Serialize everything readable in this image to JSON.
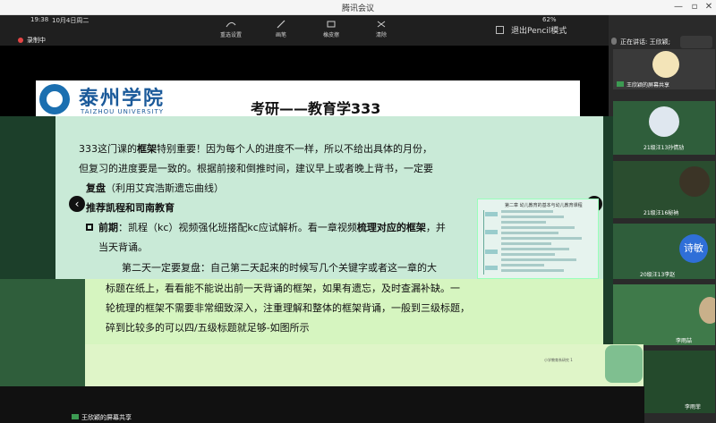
{
  "window": {
    "title": "腾讯会议"
  },
  "status": {
    "time": "19:38",
    "date": "10月4日周二",
    "battery": "62%"
  },
  "recording": {
    "label": "录制中"
  },
  "toolbar": {
    "items": [
      {
        "label": "重选设置",
        "icon": "pen-settings-icon"
      },
      {
        "label": "画笔",
        "icon": "pen-icon"
      },
      {
        "label": "橡皮擦",
        "icon": "eraser-icon"
      },
      {
        "label": "清除",
        "icon": "clear-icon"
      }
    ],
    "exit_pencil": "退出Pencil模式"
  },
  "right_panel": {
    "speaking": "正在讲话: 王欣颖;",
    "participants": [
      {
        "name": "王欣颖的屏幕共享"
      },
      {
        "name": "21级汪13孙倩劢"
      },
      {
        "name": "21级汪16秘衲"
      },
      {
        "name": "20级汪13李赵"
      },
      {
        "name": "李雨喆"
      },
      {
        "name": "李雨菲"
      }
    ],
    "poet_avatar": "诗敏"
  },
  "slide": {
    "school_cn": "泰州学院",
    "school_en": "TAIZHOU UNIVERSITY",
    "title": "考研——教育学333",
    "lines": {
      "l1_pre": "333这门课的",
      "l1_bold": "框架",
      "l1_post": "特别重要！因为每个人的进度不一样，所以不给出具体的月份，",
      "l2": "但复习的进度要是一致的。根据前接和倒推时间，建议早上或者晚上背书，一定要",
      "l3_bold": "复盘",
      "l3_post": "（利用艾宾浩斯遗忘曲线）",
      "l4": "推荐凯程和司南教育",
      "l5_bold": "前期",
      "l5_mid": "：凯程（kc）视频强化班搭配kc应试解析。看一章视频",
      "l5_bold2": "梳理对应的框架",
      "l5_post": "，并",
      "l6": "当天背诵。",
      "l7": "第二天一定要复盘：自己第二天起来的时候写几个关键字或者这一章的大",
      "l8": "标题在纸上，看看能不能说出前一天背诵的框架，如果有遗忘，及时查漏补缺。一",
      "l9": "轮梳理的框架不需要非常细致深入，注重理解和整体的框架背诵，一般到三级标题，",
      "l10": "碎到比较多的可以四/五级标题就足够-如图所示"
    },
    "mindmap_title": "第二章 幼儿教育的基本与幼儿教育课程",
    "footer": "小学教育系研究 1"
  },
  "shares": {
    "bottom_label": "王欣颖的屏幕共享"
  }
}
